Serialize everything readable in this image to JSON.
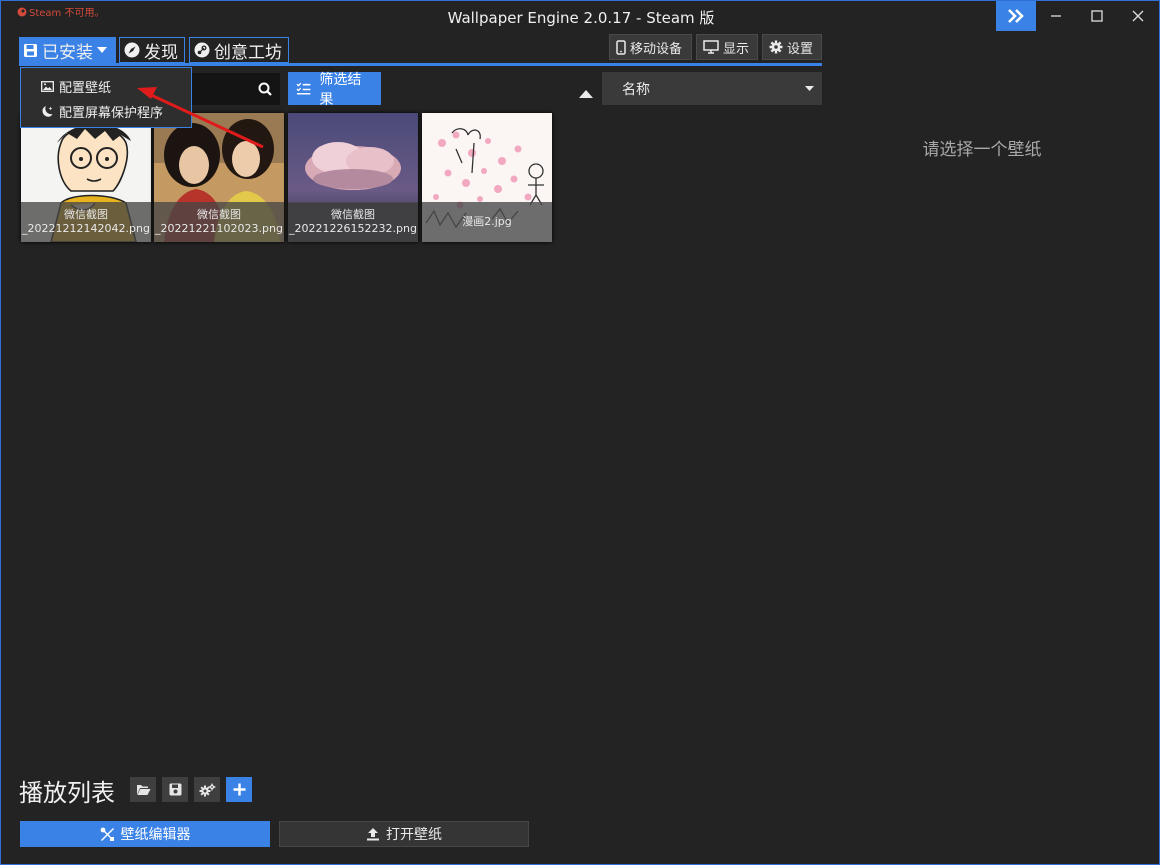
{
  "window": {
    "title": "Wallpaper Engine 2.0.17 - Steam 版",
    "steam_warning": "Steam 不可用。"
  },
  "tabs": [
    {
      "label": "已安装",
      "icon": "save-icon"
    },
    {
      "label": "发现",
      "icon": "compass-icon"
    },
    {
      "label": "创意工坊",
      "icon": "steam-icon"
    }
  ],
  "toolbar": {
    "mobile_label": "移动设备",
    "display_label": "显示",
    "settings_label": "设置"
  },
  "dropdown": {
    "items": [
      {
        "label": "配置壁纸",
        "icon": "image-icon"
      },
      {
        "label": "配置屏幕保护程序",
        "icon": "moon-icon"
      }
    ]
  },
  "filter": {
    "label": "筛选结果"
  },
  "sort": {
    "selected": "名称"
  },
  "wallpapers": [
    {
      "line1": "微信截图",
      "line2": "_20221212142042.png"
    },
    {
      "line1": "微信截图",
      "line2": "_20221221102023.png"
    },
    {
      "line1": "微信截图",
      "line2": "_20221226152232.png"
    },
    {
      "line1": "",
      "line2": "漫画2.jpg"
    }
  ],
  "preview": {
    "hint": "请选择一个壁纸"
  },
  "playlist": {
    "title": "播放列表"
  },
  "bottom": {
    "editor_label": "壁纸编辑器",
    "open_label": "打开壁纸"
  },
  "colors": {
    "accent": "#3b82e6",
    "background": "#232323",
    "annotation": "#e01b1b"
  }
}
